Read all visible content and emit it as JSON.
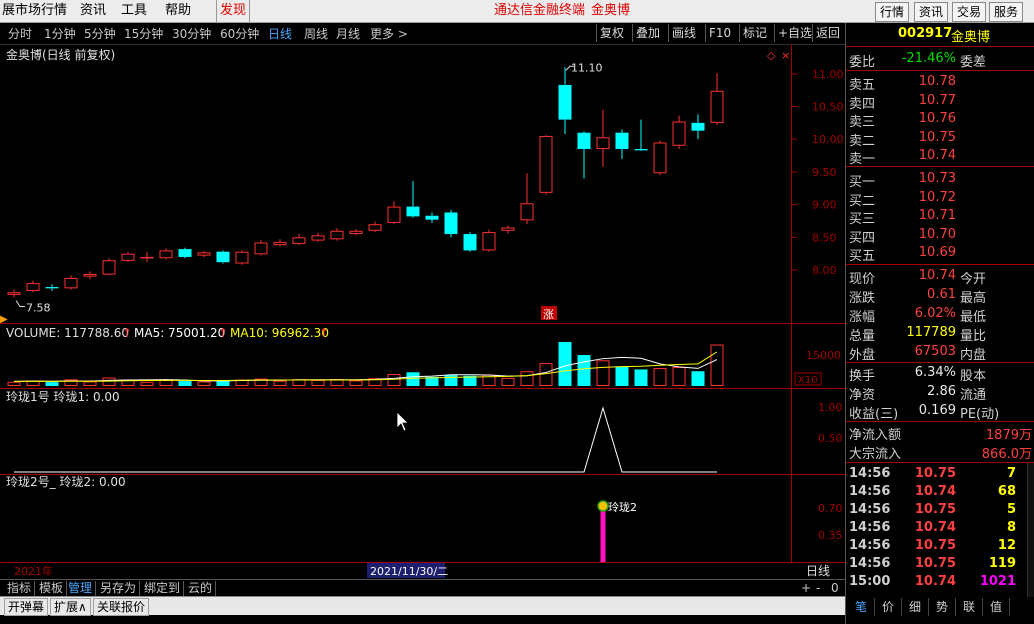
{
  "menubar": {
    "items": [
      "展市场行情",
      "资讯",
      "工具",
      "帮助",
      "发现"
    ],
    "center_title": "通达信金融终端",
    "center_stock": "金奥博",
    "right_buttons": [
      "行情",
      "资讯",
      "交易",
      "服务"
    ]
  },
  "periods": {
    "items": [
      "分时",
      "1分钟",
      "5分钟",
      "15分钟",
      "30分钟",
      "60分钟",
      "日线",
      "周线",
      "月线",
      "更多 >"
    ],
    "active": "日线",
    "tools": [
      "复权",
      "叠加",
      "画线",
      "F10",
      "标记",
      "+自选",
      "返回"
    ]
  },
  "main_chart": {
    "title": "金奥博(日线 前复权)",
    "high_label": "11.10",
    "low_label": "7.58",
    "zhang_label": "涨",
    "y_ticks": [
      "11.00",
      "10.50",
      "10.00",
      "9.50",
      "9.00",
      "8.50",
      "8.00"
    ]
  },
  "volume_panel": {
    "label": "VOLUME: 117788.60",
    "ma5": "MA5: 75001.20",
    "ma10": "MA10: 96962.30",
    "y_tick": "15000",
    "unit": "X10"
  },
  "indicator1": {
    "label": "玲珑1号  玲珑1: 0.00",
    "y_ticks": [
      "1.00",
      "0.50"
    ]
  },
  "indicator2": {
    "label": "玲珑2号_ 玲珑2: 0.00",
    "signal_text": "玲珑2",
    "y_ticks": [
      "0.70",
      "0.35"
    ]
  },
  "x_axis": {
    "year": "2021年",
    "cursor_date": "2021/11/30/二",
    "period": "日线"
  },
  "bottom_tabs": {
    "items": [
      "指标",
      "模板",
      "管理",
      "另存为",
      "绑定到",
      "云的"
    ],
    "active": "管理",
    "right_controls": [
      "+",
      "-",
      "0"
    ]
  },
  "status_bar": [
    "开弹幕",
    "扩展∧",
    "关联报价"
  ],
  "quote": {
    "code": "002917",
    "name": "金奥博",
    "weibi_label": "委比",
    "weibi_value": "-21.46%",
    "weicha_label": "委差",
    "asks": [
      {
        "label": "卖五",
        "price": "10.78"
      },
      {
        "label": "卖四",
        "price": "10.77"
      },
      {
        "label": "卖三",
        "price": "10.76"
      },
      {
        "label": "卖二",
        "price": "10.75"
      },
      {
        "label": "卖一",
        "price": "10.74"
      }
    ],
    "bids": [
      {
        "label": "买一",
        "price": "10.73"
      },
      {
        "label": "买二",
        "price": "10.72"
      },
      {
        "label": "买三",
        "price": "10.71"
      },
      {
        "label": "买四",
        "price": "10.70"
      },
      {
        "label": "买五",
        "price": "10.69"
      }
    ],
    "stats": [
      {
        "l": "现价",
        "v": "10.74",
        "c": "red",
        "r": "今开"
      },
      {
        "l": "涨跌",
        "v": "0.61",
        "c": "red",
        "r": "最高"
      },
      {
        "l": "涨幅",
        "v": "6.02%",
        "c": "red",
        "r": "最低"
      },
      {
        "l": "总量",
        "v": "117789",
        "c": "yellow",
        "r": "量比"
      },
      {
        "l": "外盘",
        "v": "67503",
        "c": "red",
        "r": "内盘"
      }
    ],
    "stats2": [
      {
        "l": "换手",
        "v": "6.34%",
        "c": "white",
        "r": "股本"
      },
      {
        "l": "净资",
        "v": "2.86",
        "c": "white",
        "r": "流通"
      },
      {
        "l": "收益(三)",
        "v": "0.169",
        "c": "white",
        "r": "PE(动)"
      }
    ],
    "flows": [
      {
        "l": "净流入额",
        "v": "1879万"
      },
      {
        "l": "大宗流入",
        "v": "866.0万"
      }
    ],
    "ticks": [
      {
        "t": "14:56",
        "p": "10.75",
        "q": "7",
        "qc": "yellow"
      },
      {
        "t": "14:56",
        "p": "10.74",
        "q": "68",
        "qc": "yellow"
      },
      {
        "t": "14:56",
        "p": "10.75",
        "q": "5",
        "qc": "yellow"
      },
      {
        "t": "14:56",
        "p": "10.74",
        "q": "8",
        "qc": "yellow"
      },
      {
        "t": "14:56",
        "p": "10.75",
        "q": "12",
        "qc": "yellow"
      },
      {
        "t": "14:56",
        "p": "10.75",
        "q": "119",
        "qc": "yellow"
      },
      {
        "t": "15:00",
        "p": "10.74",
        "q": "1021",
        "qc": "mag"
      }
    ],
    "tabs": [
      "笔",
      "价",
      "细",
      "势",
      "联",
      "值"
    ],
    "active_tab": "笔"
  },
  "colors": {
    "up": "#ff3030",
    "down": "#00ffff",
    "ma5": "#ffffff",
    "ma10": "#ffff00",
    "signal_bar": "#ff10c0",
    "axis": "#a00000"
  },
  "chart_data": {
    "type": "candlestick",
    "title": "金奥博(日线 前复权)",
    "price_range": [
      7.45,
      11.15
    ],
    "candles": [
      {
        "o": 7.62,
        "c": 7.66,
        "h": 7.7,
        "l": 7.58,
        "v": 1200
      },
      {
        "o": 7.68,
        "c": 7.8,
        "h": 7.84,
        "l": 7.66,
        "v": 1500
      },
      {
        "o": 7.74,
        "c": 7.72,
        "h": 7.78,
        "l": 7.68,
        "v": 1100
      },
      {
        "o": 7.72,
        "c": 7.88,
        "h": 7.92,
        "l": 7.7,
        "v": 1900
      },
      {
        "o": 7.9,
        "c": 7.94,
        "h": 7.98,
        "l": 7.86,
        "v": 1300
      },
      {
        "o": 7.93,
        "c": 8.15,
        "h": 8.18,
        "l": 7.92,
        "v": 2400
      },
      {
        "o": 8.14,
        "c": 8.25,
        "h": 8.28,
        "l": 8.12,
        "v": 1800
      },
      {
        "o": 8.2,
        "c": 8.2,
        "h": 8.28,
        "l": 8.12,
        "v": 1200
      },
      {
        "o": 8.18,
        "c": 8.3,
        "h": 8.33,
        "l": 8.16,
        "v": 1700
      },
      {
        "o": 8.32,
        "c": 8.2,
        "h": 8.34,
        "l": 8.18,
        "v": 1400
      },
      {
        "o": 8.22,
        "c": 8.27,
        "h": 8.29,
        "l": 8.2,
        "v": 1300
      },
      {
        "o": 8.28,
        "c": 8.12,
        "h": 8.3,
        "l": 8.1,
        "v": 1600
      },
      {
        "o": 8.1,
        "c": 8.28,
        "h": 8.3,
        "l": 8.08,
        "v": 1800
      },
      {
        "o": 8.24,
        "c": 8.42,
        "h": 8.46,
        "l": 8.22,
        "v": 2100
      },
      {
        "o": 8.38,
        "c": 8.43,
        "h": 8.47,
        "l": 8.36,
        "v": 1500
      },
      {
        "o": 8.4,
        "c": 8.5,
        "h": 8.55,
        "l": 8.38,
        "v": 1900
      },
      {
        "o": 8.45,
        "c": 8.53,
        "h": 8.57,
        "l": 8.43,
        "v": 1700
      },
      {
        "o": 8.47,
        "c": 8.6,
        "h": 8.64,
        "l": 8.45,
        "v": 2000
      },
      {
        "o": 8.55,
        "c": 8.6,
        "h": 8.63,
        "l": 8.53,
        "v": 1600
      },
      {
        "o": 8.6,
        "c": 8.7,
        "h": 8.74,
        "l": 8.58,
        "v": 2200
      },
      {
        "o": 8.72,
        "c": 8.97,
        "h": 9.05,
        "l": 8.7,
        "v": 3400
      },
      {
        "o": 8.97,
        "c": 8.82,
        "h": 9.36,
        "l": 8.8,
        "v": 3900
      },
      {
        "o": 8.83,
        "c": 8.77,
        "h": 8.88,
        "l": 8.72,
        "v": 2600
      },
      {
        "o": 8.88,
        "c": 8.55,
        "h": 8.92,
        "l": 8.5,
        "v": 3100
      },
      {
        "o": 8.55,
        "c": 8.3,
        "h": 8.58,
        "l": 8.28,
        "v": 2900
      },
      {
        "o": 8.3,
        "c": 8.58,
        "h": 8.62,
        "l": 8.28,
        "v": 3200
      },
      {
        "o": 8.6,
        "c": 8.65,
        "h": 8.68,
        "l": 8.56,
        "v": 2300
      },
      {
        "o": 8.76,
        "c": 9.02,
        "h": 9.48,
        "l": 8.7,
        "v": 4200
      },
      {
        "o": 9.18,
        "c": 10.05,
        "h": 10.06,
        "l": 9.15,
        "v": 6500
      },
      {
        "o": 10.83,
        "c": 10.3,
        "h": 11.1,
        "l": 10.08,
        "v": 12500
      },
      {
        "o": 10.1,
        "c": 9.85,
        "h": 10.12,
        "l": 9.4,
        "v": 8800
      },
      {
        "o": 9.85,
        "c": 10.03,
        "h": 10.45,
        "l": 9.58,
        "v": 7300
      },
      {
        "o": 10.1,
        "c": 9.85,
        "h": 10.15,
        "l": 9.7,
        "v": 5600
      },
      {
        "o": 9.85,
        "c": 9.83,
        "h": 10.3,
        "l": 9.82,
        "v": 4700
      },
      {
        "o": 9.48,
        "c": 9.95,
        "h": 9.98,
        "l": 9.45,
        "v": 5100
      },
      {
        "o": 9.9,
        "c": 10.27,
        "h": 10.36,
        "l": 9.85,
        "v": 5400
      },
      {
        "o": 10.25,
        "c": 10.13,
        "h": 10.38,
        "l": 10.0,
        "v": 4200
      },
      {
        "o": 10.25,
        "c": 10.74,
        "h": 11.01,
        "l": 10.22,
        "v": 11779
      }
    ],
    "ma5_volume": [
      1300,
      1400,
      1350,
      1450,
      1400,
      1600,
      1700,
      1750,
      1800,
      1700,
      1450,
      1450,
      1560,
      1640,
      1640,
      1760,
      1760,
      1760,
      1780,
      1880,
      2180,
      2620,
      2820,
      3200,
      3180,
      3140,
      2820,
      2920,
      3820,
      5720,
      6860,
      7760,
      8140,
      7880,
      6300,
      5420,
      5000,
      7500
    ],
    "ma10_volume": [
      1300,
      1350,
      1300,
      1350,
      1350,
      1400,
      1500,
      1550,
      1600,
      1600,
      1550,
      1580,
      1650,
      1700,
      1700,
      1700,
      1700,
      1720,
      1720,
      1760,
      1900,
      2200,
      2300,
      2450,
      2520,
      2620,
      2750,
      2950,
      3500,
      4300,
      4900,
      5300,
      5500,
      5600,
      5900,
      6100,
      6300,
      9696
    ],
    "indicator1_values": [
      0,
      0,
      0,
      0,
      0,
      0,
      0,
      0,
      0,
      0,
      0,
      0,
      0,
      0,
      0,
      0,
      0,
      0,
      0,
      0,
      0,
      0,
      0,
      0,
      0,
      0,
      0,
      0,
      0,
      0,
      0,
      1,
      0,
      0,
      0,
      0,
      0,
      0
    ],
    "indicator2_signal_index": 31
  }
}
